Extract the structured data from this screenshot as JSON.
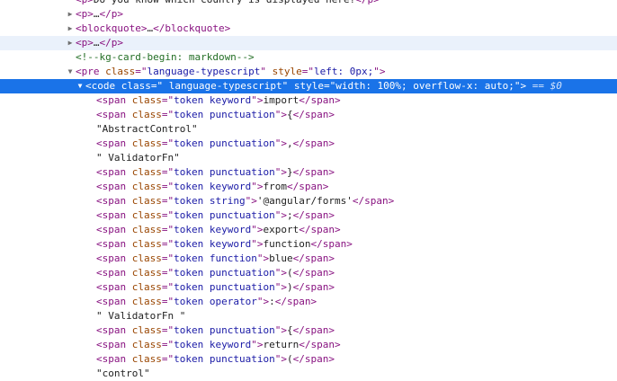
{
  "dom_tree": {
    "rows": [
      {
        "indent": 1,
        "toggle": "",
        "style": "top-cut",
        "tokens": [
          {
            "c": "tag",
            "t": "<p>"
          },
          {
            "c": "text",
            "t": "Do you know which country is displayed here?"
          },
          {
            "c": "tag",
            "t": "</p>"
          }
        ]
      },
      {
        "indent": 1,
        "toggle": "▶",
        "tokens": [
          {
            "c": "tag",
            "t": "<p>"
          },
          {
            "c": "text",
            "t": "…"
          },
          {
            "c": "tag",
            "t": "</p>"
          }
        ]
      },
      {
        "indent": 1,
        "toggle": "▶",
        "tokens": [
          {
            "c": "tag",
            "t": "<blockquote>"
          },
          {
            "c": "text",
            "t": "…"
          },
          {
            "c": "tag",
            "t": "</blockquote>"
          }
        ]
      },
      {
        "indent": 1,
        "toggle": "▶",
        "style": "hover",
        "tokens": [
          {
            "c": "tag",
            "t": "<p>"
          },
          {
            "c": "text",
            "t": "…"
          },
          {
            "c": "tag",
            "t": "</p>"
          }
        ]
      },
      {
        "indent": 1,
        "toggle": "",
        "tokens": [
          {
            "c": "comment",
            "t": "<!--kg-card-begin: markdown-->"
          }
        ]
      },
      {
        "indent": 1,
        "toggle": "▼",
        "tokens": [
          {
            "c": "tag",
            "t": "<pre "
          },
          {
            "c": "attr",
            "t": "class"
          },
          {
            "c": "punc",
            "t": "=\""
          },
          {
            "c": "val",
            "t": "language-typescript"
          },
          {
            "c": "punc",
            "t": "\" "
          },
          {
            "c": "attr",
            "t": "style"
          },
          {
            "c": "punc",
            "t": "=\""
          },
          {
            "c": "val",
            "t": "left: 0px;"
          },
          {
            "c": "punc",
            "t": "\">"
          }
        ]
      },
      {
        "indent": 2,
        "toggle": "▼",
        "style": "selected",
        "tokens": [
          {
            "c": "tag",
            "t": "<code "
          },
          {
            "c": "attr",
            "t": "class"
          },
          {
            "c": "punc",
            "t": "=\""
          },
          {
            "c": "val",
            "t": " language-typescript"
          },
          {
            "c": "punc",
            "t": "\" "
          },
          {
            "c": "attr",
            "t": "style"
          },
          {
            "c": "punc",
            "t": "=\""
          },
          {
            "c": "val",
            "t": "width: 100%; overflow-x: auto;"
          },
          {
            "c": "punc",
            "t": "\">"
          },
          {
            "c": "suffix",
            "t": " == $0"
          }
        ]
      },
      {
        "indent": 3,
        "toggle": "",
        "tokens": [
          {
            "c": "tag",
            "t": "<span "
          },
          {
            "c": "attr",
            "t": "class"
          },
          {
            "c": "punc",
            "t": "=\""
          },
          {
            "c": "val",
            "t": "token keyword"
          },
          {
            "c": "punc",
            "t": "\">"
          },
          {
            "c": "text",
            "t": "import"
          },
          {
            "c": "tag",
            "t": "</span>"
          }
        ]
      },
      {
        "indent": 3,
        "toggle": "",
        "tokens": [
          {
            "c": "tag",
            "t": "<span "
          },
          {
            "c": "attr",
            "t": "class"
          },
          {
            "c": "punc",
            "t": "=\""
          },
          {
            "c": "val",
            "t": "token punctuation"
          },
          {
            "c": "punc",
            "t": "\">"
          },
          {
            "c": "text",
            "t": "{"
          },
          {
            "c": "tag",
            "t": "</span>"
          }
        ]
      },
      {
        "indent": 3,
        "toggle": "",
        "tokens": [
          {
            "c": "text",
            "t": "\"AbstractControl\""
          }
        ]
      },
      {
        "indent": 3,
        "toggle": "",
        "tokens": [
          {
            "c": "tag",
            "t": "<span "
          },
          {
            "c": "attr",
            "t": "class"
          },
          {
            "c": "punc",
            "t": "=\""
          },
          {
            "c": "val",
            "t": "token punctuation"
          },
          {
            "c": "punc",
            "t": "\">"
          },
          {
            "c": "text",
            "t": ","
          },
          {
            "c": "tag",
            "t": "</span>"
          }
        ]
      },
      {
        "indent": 3,
        "toggle": "",
        "tokens": [
          {
            "c": "text",
            "t": "\" ValidatorFn\""
          }
        ]
      },
      {
        "indent": 3,
        "toggle": "",
        "tokens": [
          {
            "c": "tag",
            "t": "<span "
          },
          {
            "c": "attr",
            "t": "class"
          },
          {
            "c": "punc",
            "t": "=\""
          },
          {
            "c": "val",
            "t": "token punctuation"
          },
          {
            "c": "punc",
            "t": "\">"
          },
          {
            "c": "text",
            "t": "}"
          },
          {
            "c": "tag",
            "t": "</span>"
          }
        ]
      },
      {
        "indent": 3,
        "toggle": "",
        "tokens": [
          {
            "c": "tag",
            "t": "<span "
          },
          {
            "c": "attr",
            "t": "class"
          },
          {
            "c": "punc",
            "t": "=\""
          },
          {
            "c": "val",
            "t": "token keyword"
          },
          {
            "c": "punc",
            "t": "\">"
          },
          {
            "c": "text",
            "t": "from"
          },
          {
            "c": "tag",
            "t": "</span>"
          }
        ]
      },
      {
        "indent": 3,
        "toggle": "",
        "tokens": [
          {
            "c": "tag",
            "t": "<span "
          },
          {
            "c": "attr",
            "t": "class"
          },
          {
            "c": "punc",
            "t": "=\""
          },
          {
            "c": "val",
            "t": "token string"
          },
          {
            "c": "punc",
            "t": "\">"
          },
          {
            "c": "text",
            "t": "'@angular/forms'"
          },
          {
            "c": "tag",
            "t": "</span>"
          }
        ]
      },
      {
        "indent": 3,
        "toggle": "",
        "tokens": [
          {
            "c": "tag",
            "t": "<span "
          },
          {
            "c": "attr",
            "t": "class"
          },
          {
            "c": "punc",
            "t": "=\""
          },
          {
            "c": "val",
            "t": "token punctuation"
          },
          {
            "c": "punc",
            "t": "\">"
          },
          {
            "c": "text",
            "t": ";"
          },
          {
            "c": "tag",
            "t": "</span>"
          }
        ]
      },
      {
        "indent": 3,
        "toggle": "",
        "tokens": [
          {
            "c": "tag",
            "t": "<span "
          },
          {
            "c": "attr",
            "t": "class"
          },
          {
            "c": "punc",
            "t": "=\""
          },
          {
            "c": "val",
            "t": "token keyword"
          },
          {
            "c": "punc",
            "t": "\">"
          },
          {
            "c": "text",
            "t": "export"
          },
          {
            "c": "tag",
            "t": "</span>"
          }
        ]
      },
      {
        "indent": 3,
        "toggle": "",
        "tokens": [
          {
            "c": "tag",
            "t": "<span "
          },
          {
            "c": "attr",
            "t": "class"
          },
          {
            "c": "punc",
            "t": "=\""
          },
          {
            "c": "val",
            "t": "token keyword"
          },
          {
            "c": "punc",
            "t": "\">"
          },
          {
            "c": "text",
            "t": "function"
          },
          {
            "c": "tag",
            "t": "</span>"
          }
        ]
      },
      {
        "indent": 3,
        "toggle": "",
        "tokens": [
          {
            "c": "tag",
            "t": "<span "
          },
          {
            "c": "attr",
            "t": "class"
          },
          {
            "c": "punc",
            "t": "=\""
          },
          {
            "c": "val",
            "t": "token function"
          },
          {
            "c": "punc",
            "t": "\">"
          },
          {
            "c": "text",
            "t": "blue"
          },
          {
            "c": "tag",
            "t": "</span>"
          }
        ]
      },
      {
        "indent": 3,
        "toggle": "",
        "tokens": [
          {
            "c": "tag",
            "t": "<span "
          },
          {
            "c": "attr",
            "t": "class"
          },
          {
            "c": "punc",
            "t": "=\""
          },
          {
            "c": "val",
            "t": "token punctuation"
          },
          {
            "c": "punc",
            "t": "\">"
          },
          {
            "c": "text",
            "t": "("
          },
          {
            "c": "tag",
            "t": "</span>"
          }
        ]
      },
      {
        "indent": 3,
        "toggle": "",
        "tokens": [
          {
            "c": "tag",
            "t": "<span "
          },
          {
            "c": "attr",
            "t": "class"
          },
          {
            "c": "punc",
            "t": "=\""
          },
          {
            "c": "val",
            "t": "token punctuation"
          },
          {
            "c": "punc",
            "t": "\">"
          },
          {
            "c": "text",
            "t": ")"
          },
          {
            "c": "tag",
            "t": "</span>"
          }
        ]
      },
      {
        "indent": 3,
        "toggle": "",
        "tokens": [
          {
            "c": "tag",
            "t": "<span "
          },
          {
            "c": "attr",
            "t": "class"
          },
          {
            "c": "punc",
            "t": "=\""
          },
          {
            "c": "val",
            "t": "token operator"
          },
          {
            "c": "punc",
            "t": "\">"
          },
          {
            "c": "text",
            "t": ":"
          },
          {
            "c": "tag",
            "t": "</span>"
          }
        ]
      },
      {
        "indent": 3,
        "toggle": "",
        "tokens": [
          {
            "c": "text",
            "t": "\" ValidatorFn \""
          }
        ]
      },
      {
        "indent": 3,
        "toggle": "",
        "tokens": [
          {
            "c": "tag",
            "t": "<span "
          },
          {
            "c": "attr",
            "t": "class"
          },
          {
            "c": "punc",
            "t": "=\""
          },
          {
            "c": "val",
            "t": "token punctuation"
          },
          {
            "c": "punc",
            "t": "\">"
          },
          {
            "c": "text",
            "t": "{"
          },
          {
            "c": "tag",
            "t": "</span>"
          }
        ]
      },
      {
        "indent": 3,
        "toggle": "",
        "tokens": [
          {
            "c": "tag",
            "t": "<span "
          },
          {
            "c": "attr",
            "t": "class"
          },
          {
            "c": "punc",
            "t": "=\""
          },
          {
            "c": "val",
            "t": "token keyword"
          },
          {
            "c": "punc",
            "t": "\">"
          },
          {
            "c": "text",
            "t": "return"
          },
          {
            "c": "tag",
            "t": "</span>"
          }
        ]
      },
      {
        "indent": 3,
        "toggle": "",
        "tokens": [
          {
            "c": "tag",
            "t": "<span "
          },
          {
            "c": "attr",
            "t": "class"
          },
          {
            "c": "punc",
            "t": "=\""
          },
          {
            "c": "val",
            "t": "token punctuation"
          },
          {
            "c": "punc",
            "t": "\">"
          },
          {
            "c": "text",
            "t": "("
          },
          {
            "c": "tag",
            "t": "</span>"
          }
        ]
      },
      {
        "indent": 3,
        "toggle": "",
        "tokens": [
          {
            "c": "text",
            "t": "\"control\""
          }
        ]
      }
    ]
  },
  "colors": {
    "tag": "#881280",
    "attribute": "#994500",
    "value": "#1a1aa6",
    "comment": "#236e25",
    "selected_row": "#1a73e8",
    "hover_row": "#eaf1fb"
  },
  "icons": {
    "collapsed": "triangle-right-icon",
    "expanded": "triangle-down-icon"
  }
}
